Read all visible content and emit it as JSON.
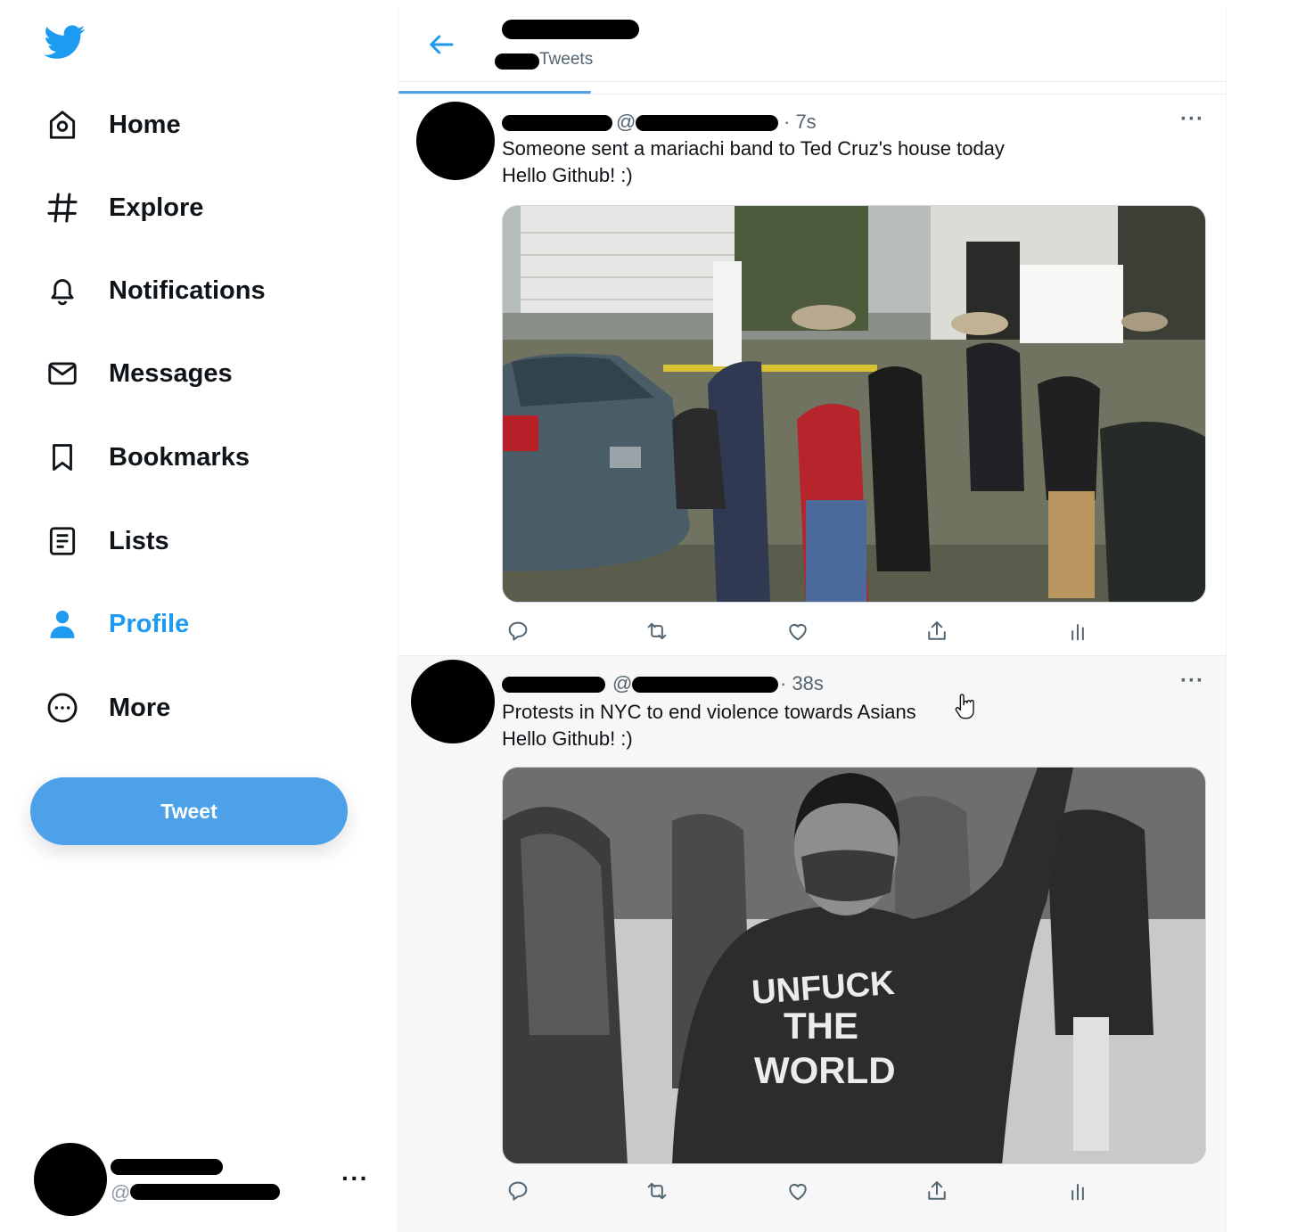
{
  "sidebar": {
    "nav": [
      {
        "label": "Home",
        "icon": "home-icon"
      },
      {
        "label": "Explore",
        "icon": "hashtag-icon"
      },
      {
        "label": "Notifications",
        "icon": "bell-icon"
      },
      {
        "label": "Messages",
        "icon": "envelope-icon"
      },
      {
        "label": "Bookmarks",
        "icon": "bookmark-icon"
      },
      {
        "label": "Lists",
        "icon": "list-icon"
      },
      {
        "label": "Profile",
        "icon": "person-icon",
        "active": true
      },
      {
        "label": "More",
        "icon": "more-circle-icon"
      }
    ],
    "tweet_button": "Tweet",
    "account": {
      "handle_prefix": "@",
      "more": "···"
    }
  },
  "header": {
    "tweet_count_label": "Tweets"
  },
  "tweets": [
    {
      "handle_prefix": "@",
      "time": "· 7s",
      "line1": "Someone sent a mariachi band to Ted Cruz's house today",
      "line2": "Hello Github! :)",
      "more": "···"
    },
    {
      "handle_prefix": "@",
      "time": "· 38s",
      "line1": "Protests in NYC to end violence towards Asians",
      "line2": "Hello Github! :)",
      "more": "···",
      "photo_text": [
        "UNFUCK",
        "THE",
        "WORLD"
      ]
    }
  ],
  "colors": {
    "accent": "#1d9bf0",
    "button": "#4da1e9",
    "text": "#0f1419",
    "muted": "#536471"
  }
}
